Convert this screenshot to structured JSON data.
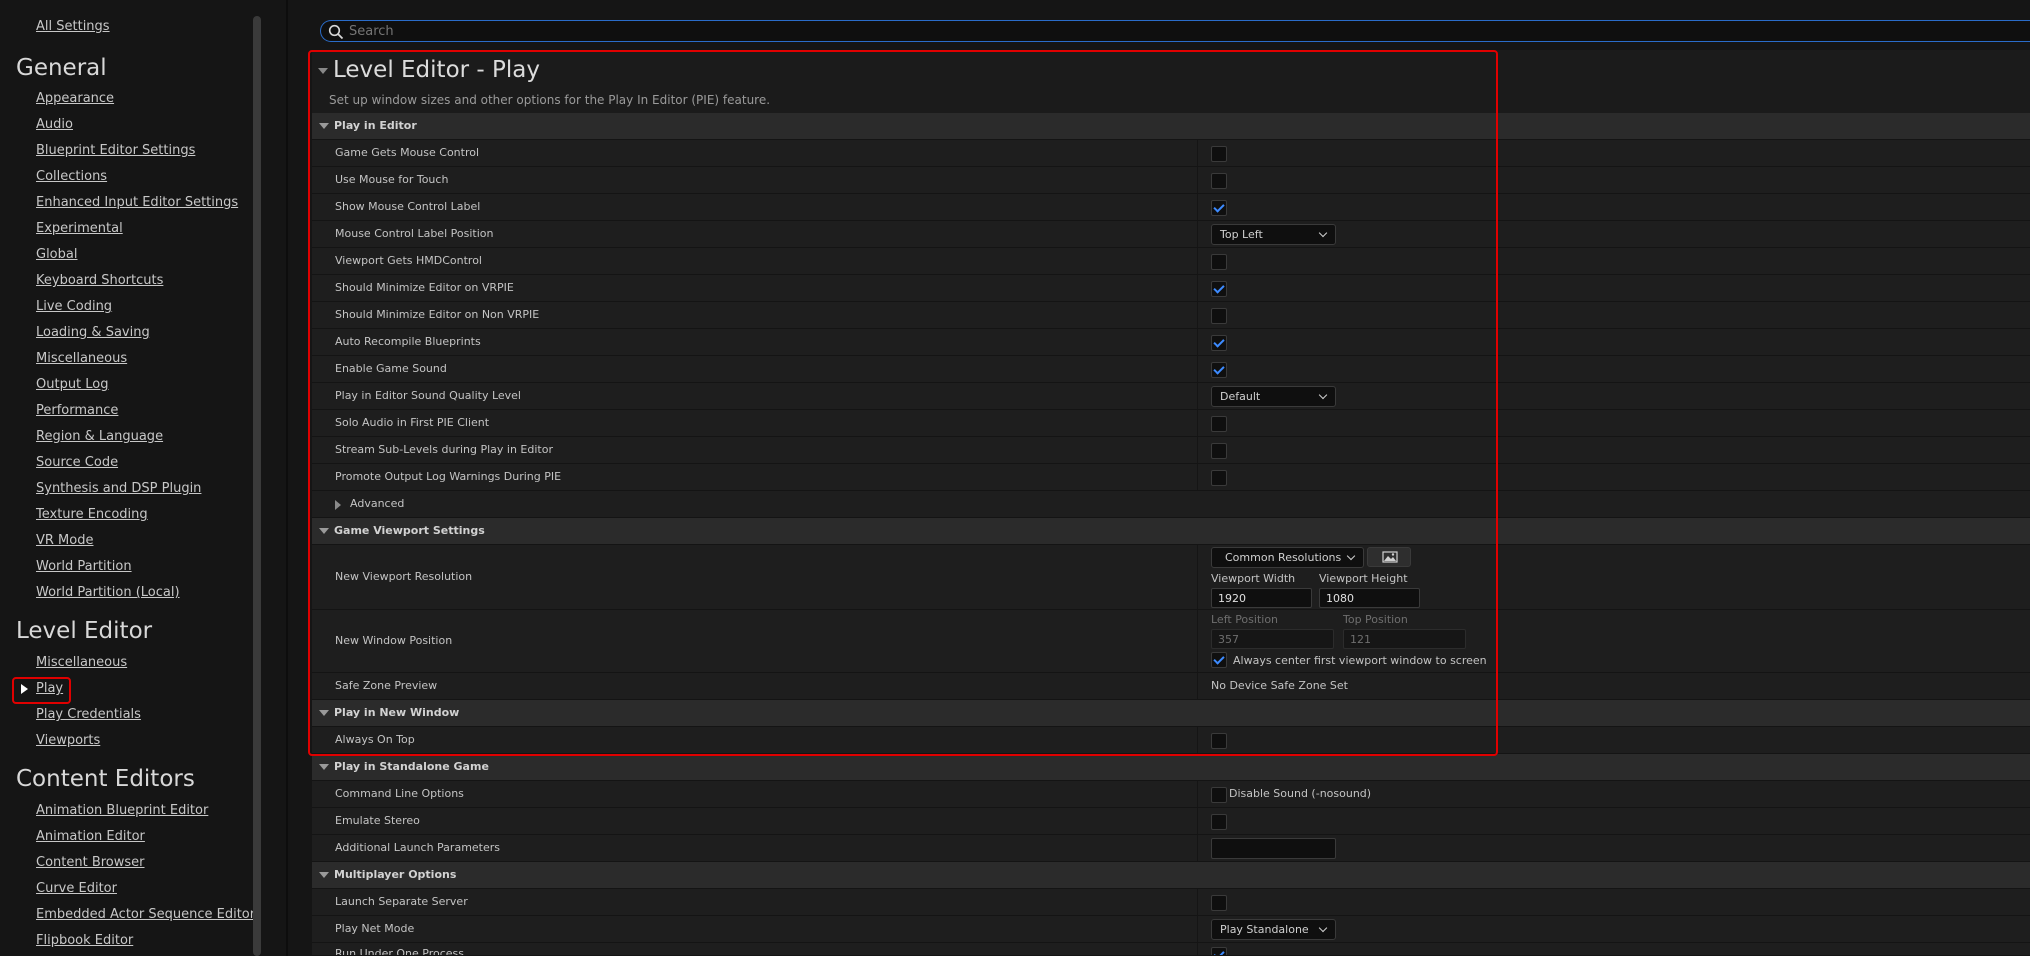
{
  "sidebar": {
    "all_settings": "All Settings",
    "sections": [
      {
        "title": "General",
        "items": [
          "Appearance",
          "Audio",
          "Blueprint Editor Settings",
          "Collections",
          "Enhanced Input Editor Settings",
          "Experimental",
          "Global",
          "Keyboard Shortcuts",
          "Live Coding",
          "Loading & Saving",
          "Miscellaneous",
          "Output Log",
          "Performance",
          "Region & Language",
          "Source Code",
          "Synthesis and DSP Plugin",
          "Texture Encoding",
          "VR Mode",
          "World Partition",
          "World Partition (Local)"
        ]
      },
      {
        "title": "Level Editor",
        "items": [
          "Miscellaneous",
          "Play",
          "Play Credentials",
          "Viewports"
        ]
      },
      {
        "title": "Content Editors",
        "items": [
          "Animation Blueprint Editor",
          "Animation Editor",
          "Content Browser",
          "Curve Editor",
          "Embedded Actor Sequence Editor",
          "Flipbook Editor"
        ]
      }
    ],
    "selected_item": "Play"
  },
  "search": {
    "placeholder": "Search"
  },
  "page": {
    "title": "Level Editor - Play",
    "subtitle": "Set up window sizes and other options for the Play In Editor (PIE) feature."
  },
  "categories": {
    "play_in_editor": "Play in Editor",
    "game_viewport": "Game Viewport Settings",
    "play_new_window": "Play in New Window",
    "play_standalone": "Play in Standalone Game",
    "multiplayer": "Multiplayer Options"
  },
  "rows": {
    "game_gets_mouse_control": {
      "label": "Game Gets Mouse Control",
      "checked": false
    },
    "use_mouse_for_touch": {
      "label": "Use Mouse for Touch",
      "checked": false
    },
    "show_mouse_control_label": {
      "label": "Show Mouse Control Label",
      "checked": true
    },
    "mouse_control_label_position": {
      "label": "Mouse Control Label Position",
      "value": "Top Left"
    },
    "viewport_gets_hmd": {
      "label": "Viewport Gets HMDControl",
      "checked": false
    },
    "minimize_vrpie": {
      "label": "Should Minimize Editor on VRPIE",
      "checked": true
    },
    "minimize_non_vrpie": {
      "label": "Should Minimize Editor on Non VRPIE",
      "checked": false
    },
    "auto_recompile": {
      "label": "Auto Recompile Blueprints",
      "checked": true
    },
    "enable_game_sound": {
      "label": "Enable Game Sound",
      "checked": true
    },
    "sound_quality_level": {
      "label": "Play in Editor Sound Quality Level",
      "value": "Default"
    },
    "solo_audio": {
      "label": "Solo Audio in First PIE Client",
      "checked": false
    },
    "stream_sublevels": {
      "label": "Stream Sub-Levels during Play in Editor",
      "checked": false
    },
    "promote_warnings": {
      "label": "Promote Output Log Warnings During PIE",
      "checked": false
    },
    "advanced": {
      "label": "Advanced"
    },
    "new_viewport_resolution": {
      "label": "New Viewport Resolution",
      "dropdown": "Common Resolutions",
      "width_label": "Viewport Width",
      "width": "1920",
      "height_label": "Viewport Height",
      "height": "1080"
    },
    "new_window_position": {
      "label": "New Window Position",
      "left_label": "Left Position",
      "left": "357",
      "top_label": "Top Position",
      "top": "121",
      "center_label": "Always center first viewport window to screen",
      "center_checked": true
    },
    "safe_zone_preview": {
      "label": "Safe Zone Preview",
      "value": "No Device Safe Zone Set"
    },
    "always_on_top": {
      "label": "Always On Top",
      "checked": false
    },
    "command_line_options": {
      "label": "Command Line Options",
      "option": "Disable Sound (-nosound)",
      "checked": false
    },
    "emulate_stereo": {
      "label": "Emulate Stereo",
      "checked": false
    },
    "additional_launch_params": {
      "label": "Additional Launch Parameters",
      "value": ""
    },
    "launch_separate_server": {
      "label": "Launch Separate Server",
      "checked": false
    },
    "play_net_mode": {
      "label": "Play Net Mode",
      "value": "Play Standalone"
    },
    "run_under_one_process": {
      "label": "Run Under One Process",
      "checked": true
    }
  },
  "colors": {
    "accent": "#3d8bff",
    "highlight": "#e00000",
    "background": "#151515"
  }
}
